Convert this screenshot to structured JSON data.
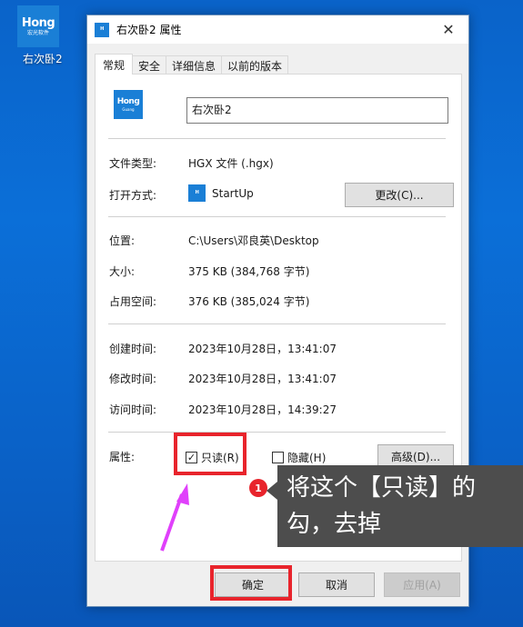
{
  "desktop": {
    "icon": {
      "logo_line1": "Hong",
      "logo_line2": "宏光软件",
      "label": "右次卧2"
    }
  },
  "window": {
    "title": "右次卧2 属性",
    "close_glyph": "✕",
    "tabs": [
      {
        "label": "常规",
        "active": true
      },
      {
        "label": "安全"
      },
      {
        "label": "详细信息"
      },
      {
        "label": "以前的版本"
      }
    ],
    "general": {
      "file_name": "右次卧2",
      "file_type_label": "文件类型:",
      "file_type_value": "HGX 文件 (.hgx)",
      "open_with_label": "打开方式:",
      "open_with_value": "StartUp",
      "change_button": "更改(C)...",
      "location_label": "位置:",
      "location_value": "C:\\Users\\邓良英\\Desktop",
      "size_label": "大小:",
      "size_value": "375 KB (384,768 字节)",
      "disk_size_label": "占用空间:",
      "disk_size_value": "376 KB (385,024 字节)",
      "created_label": "创建时间:",
      "created_value": "2023年10月28日，13:41:07",
      "modified_label": "修改时间:",
      "modified_value": "2023年10月28日，13:41:07",
      "accessed_label": "访问时间:",
      "accessed_value": "2023年10月28日，14:39:27",
      "attributes_label": "属性:",
      "readonly_label": "只读(R)",
      "readonly_checked": true,
      "hidden_label": "隐藏(H)",
      "hidden_checked": false,
      "advanced_button": "高级(D)..."
    },
    "footer": {
      "ok_button": "确定",
      "cancel_button": "取消",
      "apply_button": "应用(A)"
    }
  },
  "annotation": {
    "step_number": "1",
    "text": "将这个【只读】的勾，去掉",
    "highlight_color": "#e8242c",
    "arrow_color": "#e040fb"
  }
}
